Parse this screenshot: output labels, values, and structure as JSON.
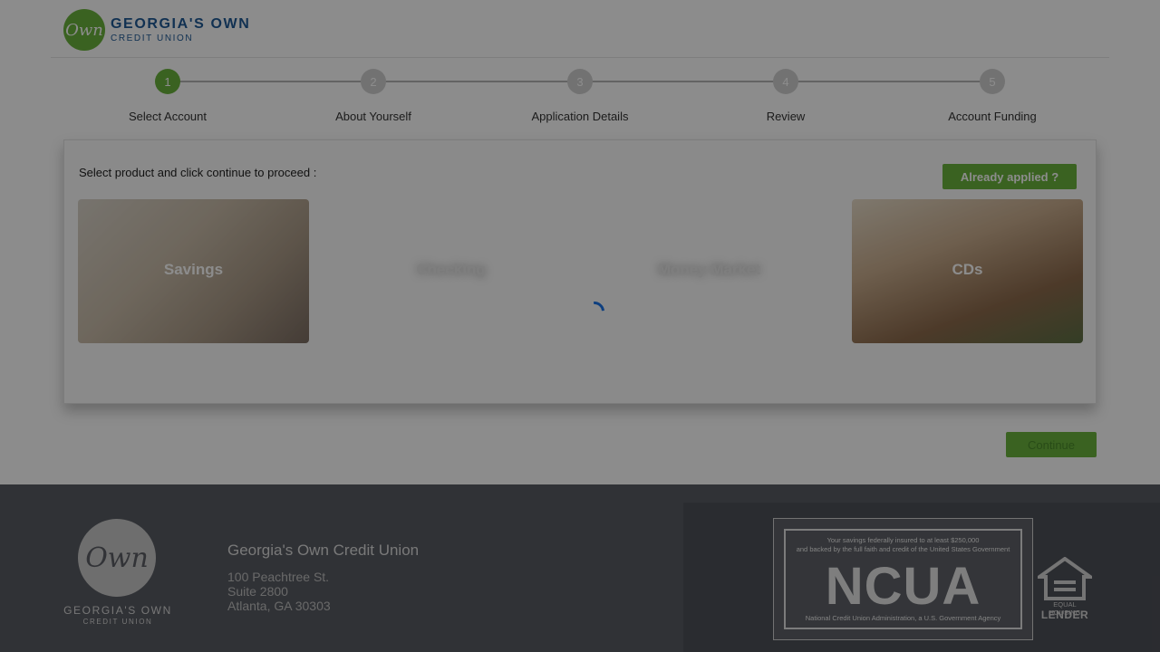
{
  "brand": {
    "logo_mark": "Own",
    "name": "GEORGIA'S OWN",
    "sub": "CREDIT UNION"
  },
  "stepper": {
    "steps": [
      {
        "number": "1",
        "label": "Select Account",
        "active": true
      },
      {
        "number": "2",
        "label": "About Yourself",
        "active": false
      },
      {
        "number": "3",
        "label": "Application Details",
        "active": false
      },
      {
        "number": "4",
        "label": "Review",
        "active": false
      },
      {
        "number": "5",
        "label": "Account Funding",
        "active": false
      }
    ]
  },
  "product_selector": {
    "prompt": "Select product and click continue to proceed :",
    "already_applied_label": "Already applied ?",
    "products": [
      {
        "title": "Savings"
      },
      {
        "title": "Checking"
      },
      {
        "title": "Money Market"
      },
      {
        "title": "CDs"
      }
    ]
  },
  "actions": {
    "continue_label": "Continue"
  },
  "footer": {
    "logo_mark": "Own",
    "logo_name": "GEORGIA'S OWN",
    "logo_sub": "CREDIT UNION",
    "org_name": "Georgia's Own Credit Union",
    "address": [
      "100 Peachtree St.",
      "Suite 2800",
      "Atlanta, GA 30303"
    ],
    "ncua": {
      "top_line1": "Your savings federally insured to at least $250,000",
      "top_line2": "and backed by the full faith and credit of the United States Government",
      "big": "NCUA",
      "bottom": "National Credit Union Administration, a U.S. Government Agency"
    },
    "equal_housing": {
      "line1": "EQUAL HOUSING",
      "line2": "LENDER"
    }
  },
  "colors": {
    "brand_green": "#6bb33d",
    "brand_blue": "#1f5a96",
    "spinner_blue": "#1a73e8"
  }
}
